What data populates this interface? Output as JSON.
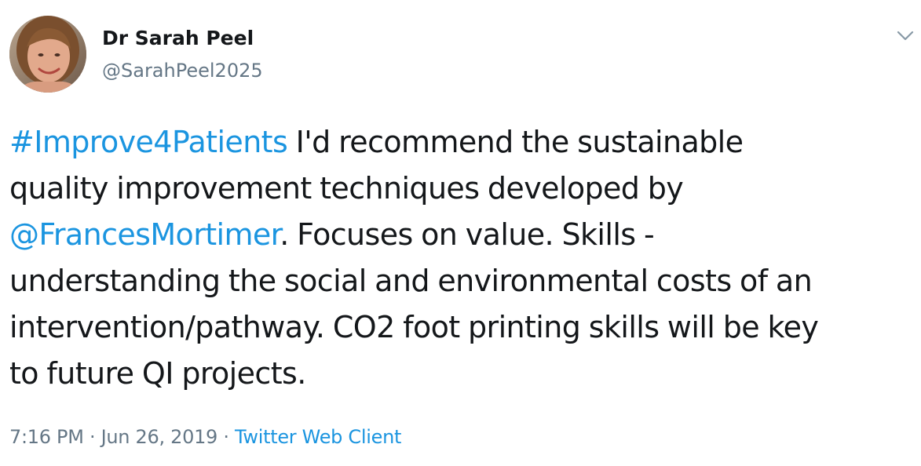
{
  "author": {
    "display_name": "Dr Sarah Peel",
    "handle": "@SarahPeel2025"
  },
  "tweet": {
    "line1": {
      "hashtag": "#Improve4Patients",
      "rest": " I'd recommend the sustainable"
    },
    "line2": {
      "text": "quality improvement techniques developed by"
    },
    "line3": {
      "mention": "@FrancesMortimer",
      "rest": ". Focuses on value. Skills -"
    },
    "line4": {
      "text": "understanding the social and environmental costs of an"
    },
    "line5": {
      "text": "intervention/pathway. CO2 foot printing skills will be key"
    },
    "line6": {
      "text": "to future QI projects."
    }
  },
  "meta": {
    "time": "7:16 PM",
    "separator1": " · ",
    "date": "Jun 26, 2019",
    "separator2": " · ",
    "source": "Twitter Web Client"
  },
  "icons": {
    "caret": "chevron-down-icon"
  },
  "colors": {
    "link": "#1b95e0",
    "text": "#14171a",
    "secondary": "#657786"
  }
}
